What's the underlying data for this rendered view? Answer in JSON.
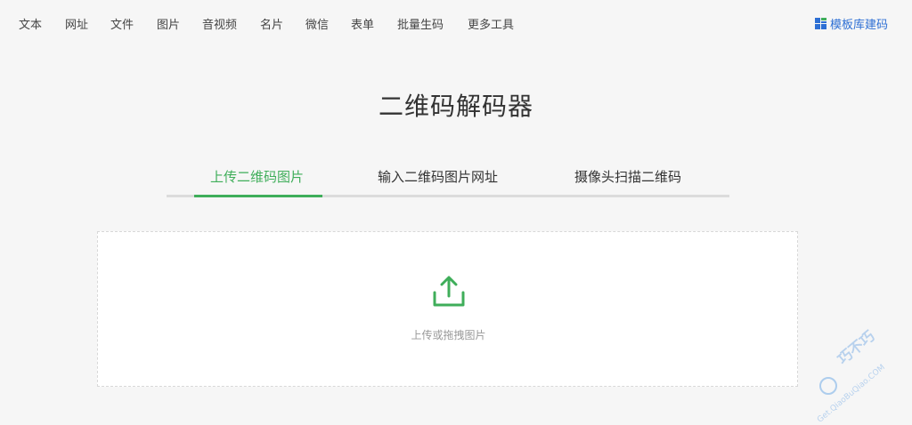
{
  "nav": {
    "items": [
      "文本",
      "网址",
      "文件",
      "图片",
      "音视频",
      "名片",
      "微信",
      "表单",
      "批量生码",
      "更多工具"
    ],
    "brand_label": "模板库建码"
  },
  "main": {
    "title": "二维码解码器",
    "tabs": [
      {
        "label": "上传二维码图片",
        "active": true
      },
      {
        "label": "输入二维码图片网址",
        "active": false
      },
      {
        "label": "摄像头扫描二维码",
        "active": false
      }
    ],
    "upload_text": "上传或拖拽图片",
    "upload_icon": "upload-icon"
  },
  "watermark": {
    "main": "巧不巧",
    "sub": "Get.QiaoBuQiao.COM"
  },
  "colors": {
    "accent": "#3fae5a",
    "brand": "#2d6fd4"
  }
}
